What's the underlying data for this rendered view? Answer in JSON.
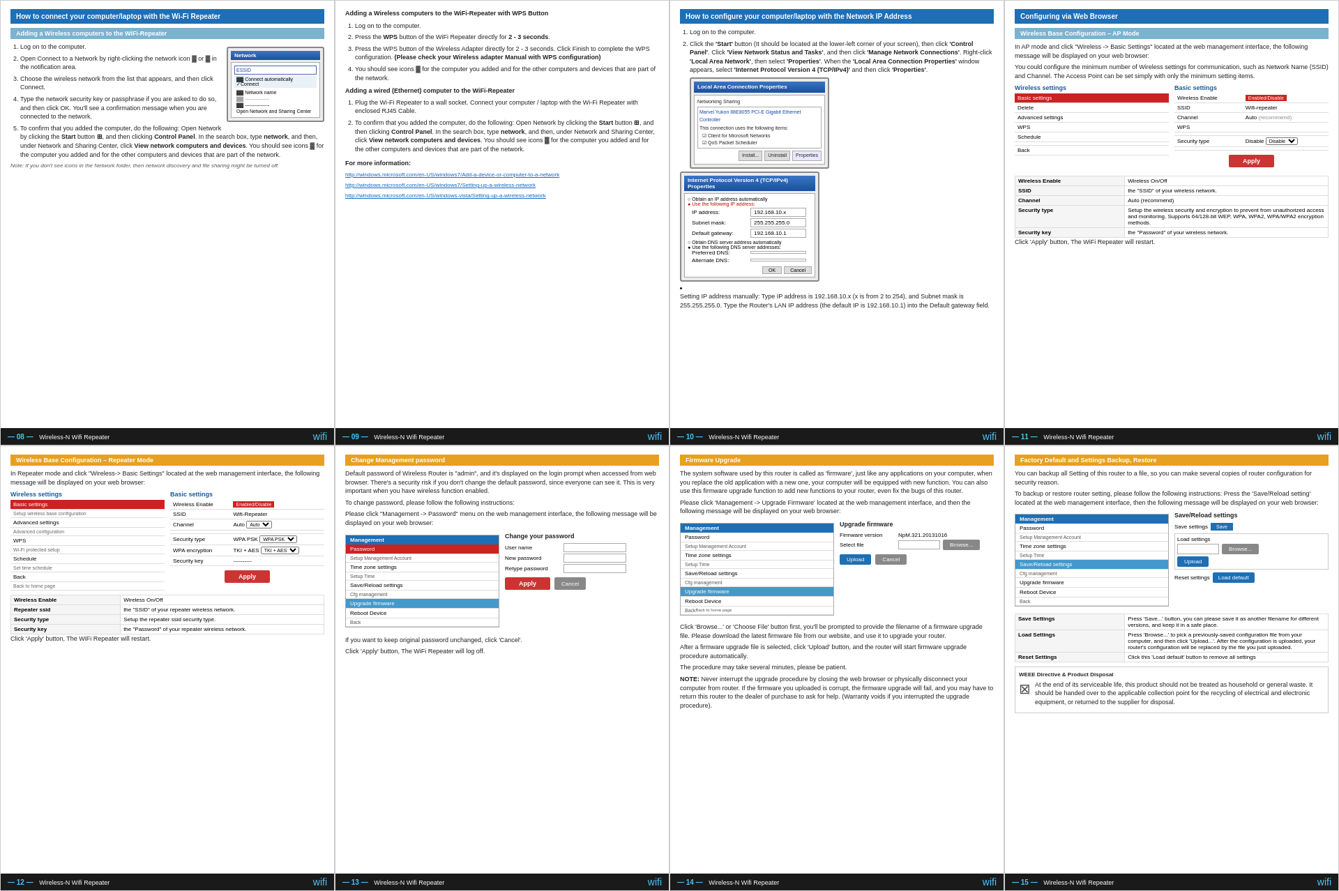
{
  "pages": {
    "p08": {
      "number": "08",
      "brand": "Wireless-N Wifi Repeater",
      "title_header": "Wireless Base Configuration – Repeater Mode",
      "intro": "In Repeater mode and click \"Wireless-> Basic Settings\" located at the web management interface, the following message will be displayed on your web browser:",
      "wireless_label": "Wireless settings",
      "basic_label": "Basic settings",
      "table_rows": [
        {
          "col1": "Basic settings",
          "col2": "Wireless Enable",
          "col3": "Enabled/Disable",
          "highlight": true,
          "active": true
        },
        {
          "col1": "Delete",
          "col2": "SSID",
          "col3": "Wifi-Repeater",
          "highlight": false
        },
        {
          "col1": "Advanced settings",
          "col2": "Channel",
          "col3": "Auto",
          "highlight": false
        },
        {
          "col1": "WPS",
          "col2": "",
          "col3": "",
          "highlight": false
        },
        {
          "col1": "Schedule",
          "col2": "Security type",
          "col3": "WPA PSK",
          "highlight": false
        },
        {
          "col1": "Back",
          "col2": "WPA encryption",
          "col3": "TKI + AES",
          "highlight": false
        },
        {
          "col1": "",
          "col2": "Security key",
          "col3": "----------",
          "highlight": false
        }
      ],
      "apply_label": "Apply",
      "info_rows": [
        {
          "label": "Wireless Enable",
          "value": "Wireless On/Off"
        },
        {
          "label": "Repeater ssid",
          "value": "the \"SSID\" of your repeater wireless network."
        },
        {
          "label": "Security type",
          "value": "Setup the repeater ssid security type."
        },
        {
          "label": "Security key",
          "value": "the \"Password\" of your repeater wireless network."
        }
      ],
      "click_apply": "Click 'Apply' button, The WiFi Repeater will restart."
    },
    "p09": {
      "number": "09",
      "brand": "Wireless-N Wifi Repeater",
      "title_header": "Change Management password",
      "intro1": "Default password of Wireless Router is \"admin\", and it's displayed on the login prompt when accessed from web browser. There's a security risk if you don't change the default password, since everyone can see it. This is very important when you have wireless function enabled.",
      "intro2": "To change password, please follow the following instructions:",
      "intro3": "Please click \"Management -> Password\" menu on the web management interface, the following message will be displayed on your web browser:",
      "mgmt_title": "Management",
      "change_pw_title": "Change your password",
      "mgmt_items": [
        {
          "label": "Password",
          "active": true
        },
        {
          "label": "Setup Management Account"
        },
        {
          "label": "Time zone settings"
        },
        {
          "label": "Setup Time"
        },
        {
          "label": "Save/Reload settings"
        },
        {
          "label": "Cfg management"
        },
        {
          "label": "Upgrade firmware",
          "highlight": true
        },
        {
          "label": "Reboot Device"
        },
        {
          "label": "Back"
        }
      ],
      "input_labels": [
        "User name",
        "New password",
        "Retype password"
      ],
      "apply_label": "Apply",
      "cancel_label": "Cancel",
      "note1": "If you want to keep original password unchanged, click 'Cancel'.",
      "note2": "Click 'Apply' button, The WiFi Repeater will log off."
    },
    "p10": {
      "number": "10",
      "brand": "Wireless-N Wifi Repeater",
      "title_header": "Firmware Upgrade",
      "intro": "The system software used by this router is called as 'firmware', just like any applications on your computer, when you replace the old application with a new one, your computer will be equipped with new function. You can also use this firmware upgrade function to add new functions to your router, even fix the bugs of this router.",
      "intro2": "Please click 'Management -> Upgrade Firmware' located at the web management interface, and then the following message will be displayed on your web browser:",
      "mgmt_title": "Management",
      "upgrade_title": "Upgrade firmware",
      "mgmt_items": [
        {
          "label": "Password"
        },
        {
          "label": "Setup Management Account"
        },
        {
          "label": "Time zone settings"
        },
        {
          "label": "Setup Time"
        },
        {
          "label": "Save/Reload settings"
        },
        {
          "label": "Cfg management"
        },
        {
          "label": "Upgrade firmware",
          "highlight": true
        },
        {
          "label": "Reboot Device"
        },
        {
          "label": "Back"
        }
      ],
      "firmware_version_label": "Firmware version",
      "firmware_version": "NpM.321.20131016",
      "select_file_label": "Select file",
      "browse_label": "Browse...",
      "upload_label": "Upload",
      "cancel_label": "Cancel",
      "note1": "Click 'Browse...' or 'Choose File' button first, you'll be prompted to provide the filename of a firmware upgrade file. Please download the latest firmware file from our website, and use it to upgrade your router.",
      "note2": "After a firmware upgrade file is selected, click 'Upload' button, and the router will start firmware upgrade procedure automatically.",
      "note3": "The procedure may take several minutes, please be patient.",
      "note_title": "NOTE:",
      "note_body": "Never interrupt the upgrade procedure by closing the web browser or physically disconnect your computer from router. If the firmware you uploaded is corrupt, the firmware upgrade will fail, and you may have to return this router to the dealer of purchase to ask for help. (Warranty voids if you interrupted the upgrade procedure)."
    },
    "p11": {
      "number": "11",
      "brand": "Wireless-N Wifi Repeater",
      "title_header": "Factory Default and Settings Backup, Restore",
      "intro": "You can backup all Setting of this router to a file, so you can make several copies of router configuration for security reason.",
      "intro2": "To backup or restore router setting, please follow the following instructions: Press the 'Save/Reload setting' located at the web management interface, then the following message will be displayed on your web browser:",
      "mgmt_title": "Management",
      "save_reload_title": "Save/Reload settings",
      "mgmt_items": [
        {
          "label": "Password"
        },
        {
          "label": "Setup Management Account"
        },
        {
          "label": "Time zone settings"
        },
        {
          "label": "Setup Time"
        },
        {
          "label": "Save/Reload settings",
          "highlight": true
        },
        {
          "label": "Cfg management"
        },
        {
          "label": "Upgrade firmware"
        },
        {
          "label": "Reboot Device"
        },
        {
          "label": "Back"
        }
      ],
      "save_label": "Save",
      "load_settings_label": "Load settings",
      "browse_label": "Browse...",
      "upload_label": "Upload",
      "reset_settings_label": "Reset settings",
      "load_default_label": "Load default",
      "info_rows": [
        {
          "label": "Save Settings",
          "value": "Press 'Save...' button, you can please save it as another filename for different versions, and keep it in a safe place."
        },
        {
          "label": "Load Settings",
          "value": "Press 'Browse...' to pick a previously-saved configuration file from your computer, and then click 'Upload...'. After the configuration is uploaded, your router's configuration will be replaced by the file you just uploaded."
        },
        {
          "label": "Reset Settings",
          "value": "Click this 'Load default' button to remove all settings"
        }
      ],
      "weee_title": "WEEE Directive & Product Disposal",
      "weee_text": "At the end of its serviceable life, this product should not be treated as household or general waste. It should be handed over to the applicable collection point for the recycling of electrical and electronic equipment, or returned to the supplier for disposal."
    },
    "p_top_left": {
      "number": "",
      "title_header": "How to connect your computer/laptop with the Wi-Fi Repeater",
      "section1": "Adding a Wireless computers to the WiFi-Repeater",
      "steps": [
        "Log on to the computer.",
        "Open Connect to a Network by right-clicking the network icon or in the notification area.",
        "Choose the wireless network from the list that appears, and then click Connect.",
        "Type the network security key or passphrase if you are asked to do so, and then click OK. You'll see a confirmation message when you are connected to the network.",
        "To confirm that you added the computer, do the following: Open Network by clicking the Start button, and then clicking Control Panel. In the search box, type network, and then, under Network and Sharing Center, click View network computers and devices. You should see icons for the computer you added and for the other computers and devices that are part of the network."
      ],
      "note": "Note: If you don't see icons in the Network folder, then network discovery and file sharing might be turned off."
    },
    "p_top_mid_left": {
      "wps_title": "Adding a Wireless computers to the WiFi-Repeater with WPS Button",
      "wps_steps": [
        "Log on to the computer.",
        "Press the WPS button of the WiFi Repeater directly for 2 - 3 seconds.",
        "Press the WPS button of the Wireless Adapter directly for 2 - 3 seconds. Click Finish to complete the WPS configuration. (Please check your Wireless adapter Manual with WPS configuration)",
        "You should see icons for the computer you added and for the other computers and devices that are part of the network."
      ],
      "ethernet_title": "Adding a wired (Ethernet) computer to the WiFi-Repeater",
      "ethernet_steps": [
        "Plug the Wi-Fi Repeater to a wall socket. Connect your computer / laptop with the Wi-Fi Repeater with enclosed RJ45 Cable.",
        "To confirm that you added the computer, do the following: Open Network by clicking the Start button, and then clicking Control Panel. In the search box, type network, and then, under Network and Sharing Center, click View network computers and devices. You should see icons for the computer you added and for the other computers and devices that are part of the network."
      ],
      "more_info": "For more information:",
      "links": [
        "http://windows.microsoft.com/en-US/windows7/Add-a-device-or-computer-to-a-network",
        "http://windows.microsoft.com/en-US/windows7/Setting-up-a-wireless-network",
        "http://windows.microsoft.com/en-US/windows-vista/Setting-up-a-wireless-network"
      ]
    },
    "p_top_mid_right": {
      "title_header": "How to configure your computer/laptop with the Network IP Address",
      "steps": [
        "Log on to the computer.",
        "Click the 'Start' button (It should be located at the lower-left corner of your screen), then click 'Control Panel'. Click 'View Network Status and Tasks', and then click 'Manage Network Connections'. Right-click 'Local Area Network', then select 'Properties'. When the 'Local Area Connection Properties' window appears, select 'Internet Protocol Version 4 (TCP/IPv4)' and then click 'Properties'.",
        "Setting IP address manually: Type IP address is 192.168.10.x (x is from 2 to 254), and Subnet mask is 255.255.255.0. Type the Router's LAN IP address (the default IP is 192.168.10.1) into the Default gateway field."
      ]
    },
    "p_top_right": {
      "title_header": "Configuring via Web Browser",
      "section1": "Wireless Base Configuration – AP Mode",
      "intro": "In AP mode and click \"Wireless -> Basic Settings\" located at the web management interface, the following message will be displayed on your web browser:",
      "intro2": "You could configure the minimum number of Wireless settings for communication, such as Network Name (SSID) and Channel. The Access Point can be set simply with only the minimum setting items.",
      "wireless_label": "Wireless settings",
      "basic_label": "Basic settings",
      "table_rows": [
        {
          "col1": "Basic settings",
          "col2": "Wireless Enable",
          "col3": "Enabled/Disable",
          "active": true
        },
        {
          "col1": "Delete",
          "col2": "SSID",
          "col3": "Wifi-repeater"
        },
        {
          "col1": "Advanced settings",
          "col2": "Channel",
          "col3": "Auto (recommend)"
        },
        {
          "col1": "WPS",
          "col2": "WPS",
          "col3": ""
        },
        {
          "col1": "Schedule",
          "col2": "",
          "col3": ""
        },
        {
          "col1": "",
          "col2": "Security type",
          "col3": "Disable"
        },
        {
          "col1": "Back",
          "col2": "",
          "col3": ""
        }
      ],
      "apply_label": "Apply",
      "info_rows": [
        {
          "label": "Wireless Enable",
          "value": "Wireless On/Off"
        },
        {
          "label": "SSID",
          "value": "the \"SSID\" of your wireless network."
        },
        {
          "label": "Channel",
          "value": "Auto (recommend)"
        },
        {
          "label": "Security type",
          "value": "Setup the wireless security and encryption to prevent from unauthorized access and monitoring. Supports 64/128-bit WEP, WPA, WPA2, WPA/WPA2 encryption methods."
        },
        {
          "label": "Security key",
          "value": "the \"Password\" of your wireless network."
        }
      ],
      "click_apply": "Click 'Apply' button, The WiFi Repeater will restart."
    }
  }
}
